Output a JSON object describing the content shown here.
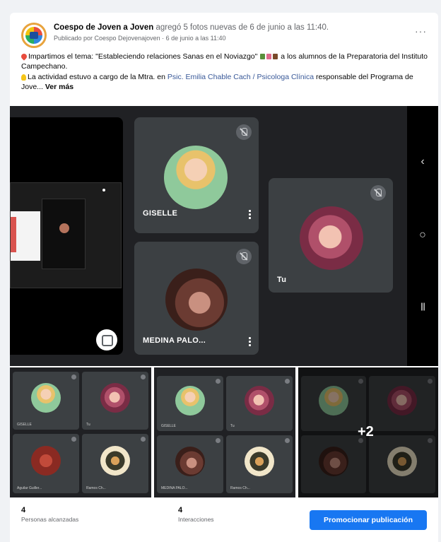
{
  "post": {
    "author": "Coespo de Joven a Joven",
    "action": " agregó 5 fotos nuevas de 6 de junio a las 11:40.",
    "published_by": "Publicado por Coespo Dejovenajoven · 6 de junio a las 11:40",
    "more_label": "···",
    "line1": "Impartimos el tema: \"Estableciendo relaciones Sanas en el Noviazgo\"",
    "line1_end": "a los alumnos de la Preparatoria del Instituto Campechano.",
    "line2_start": "La actividad estuvo a cargo de la Mtra. en ",
    "line2_link": "Psic. Emilia Chable Cach / Psicologa Clínica",
    "line2_end": " responsable del Programa de Jove...",
    "see_more": "Ver más"
  },
  "call": {
    "tiles": [
      {
        "name": "GISELLE"
      },
      {
        "name": "Tu"
      },
      {
        "name": "MEDINA PALO..."
      }
    ],
    "nav_icons": [
      "chevron-left-icon",
      "home-circle-icon",
      "recents-icon"
    ]
  },
  "thumbnails": {
    "mini_labels": [
      "GISELLE",
      "Tu",
      "Aguilar Guiller...",
      "Ramos Ch..."
    ],
    "mini_labels_b": [
      "GISELLE",
      "Tu",
      "MEDINA PALO...",
      "Ramos Ch..."
    ],
    "more_count": "+2"
  },
  "footer": {
    "reach_count": "4",
    "reach_label": "Personas alcanzadas",
    "interactions_count": "4",
    "interactions_label": "Interacciones",
    "promote_label": "Promocionar publicación"
  },
  "colors": {
    "accent": "#1877f2",
    "call_bg": "#202124",
    "tile_bg": "#3c4043"
  }
}
